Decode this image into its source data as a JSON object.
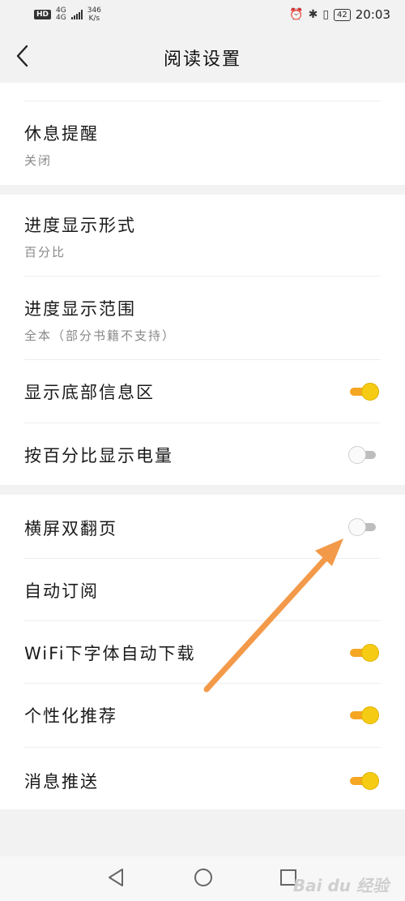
{
  "status": {
    "hd": "HD",
    "net_top": "4G",
    "net_bottom": "4G",
    "speed_top": "346",
    "speed_bottom": "K/s",
    "battery": "42",
    "time": "20:03"
  },
  "header": {
    "title": "阅读设置"
  },
  "settings": {
    "rest_reminder": {
      "label": "休息提醒",
      "value": "关闭"
    },
    "progress_format": {
      "label": "进度显示形式",
      "value": "百分比"
    },
    "progress_range": {
      "label": "进度显示范围",
      "value": "全本（部分书籍不支持）"
    },
    "show_footer": {
      "label": "显示底部信息区",
      "on": true
    },
    "battery_percent": {
      "label": "按百分比显示电量",
      "on": false
    },
    "landscape_double": {
      "label": "横屏双翻页",
      "on": false
    },
    "auto_subscribe": {
      "label": "自动订阅"
    },
    "wifi_font_download": {
      "label": "WiFi下字体自动下载",
      "on": true
    },
    "personalized": {
      "label": "个性化推荐",
      "on": true
    },
    "push": {
      "label": "消息推送",
      "on": true
    }
  },
  "watermark": "Bai du 经验",
  "colors": {
    "toggle_on": "#f5cc13",
    "toggle_track_on": "#f5a623",
    "toggle_off": "#bdbdbd",
    "arrow": "#f39a4a"
  }
}
